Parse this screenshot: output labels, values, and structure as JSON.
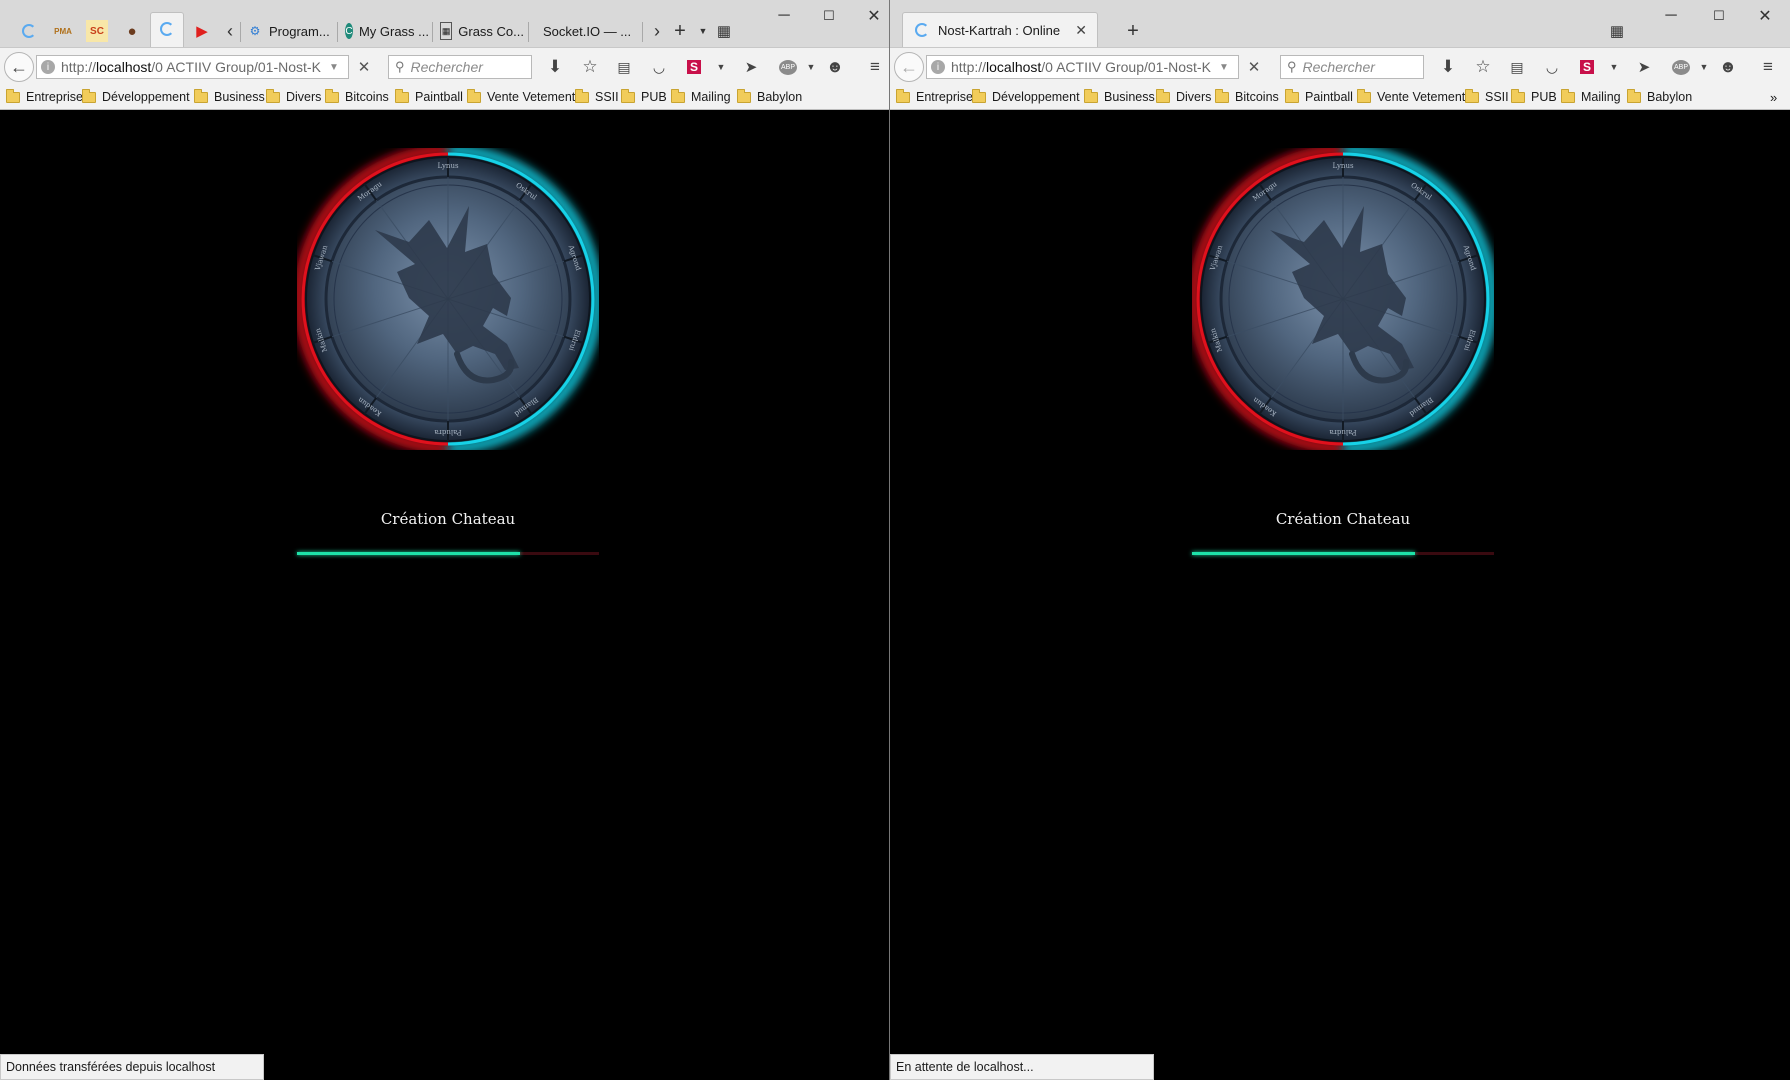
{
  "left_window": {
    "tabs": [
      {
        "title": "Program...",
        "favicon": "gear-icon"
      },
      {
        "title": "My Grass ...",
        "favicon": "grass-icon"
      },
      {
        "title": "Grass Co...",
        "favicon": "calculator-icon"
      },
      {
        "title": "Socket.IO — ...",
        "favicon": "socketio-icon"
      }
    ],
    "pinned_tabs": [
      "firefox-spinner-icon",
      "phpmyadmin-icon",
      "soc-icon",
      "wolf-icon",
      "firefox-spinner-icon",
      "youtube-icon"
    ],
    "pinned_texts": [
      "PMA",
      "SC"
    ],
    "url_prefix": "http://",
    "url_host": "localhost",
    "url_rest": "/0 ACTIIV Group/01-Nost-K",
    "search_placeholder": "Rechercher",
    "status": "Données transférées depuis localhost"
  },
  "right_window": {
    "active_tab_title": "Nost-Kartrah : Online",
    "url_prefix": "http://",
    "url_host": "localhost",
    "url_rest": "/0 ACTIIV Group/01-Nost-K",
    "search_placeholder": "Rechercher",
    "status": "En attente de localhost..."
  },
  "toolbar_icons": [
    "download-icon",
    "star-icon",
    "reader-icon",
    "pocket-icon",
    "s-addon-icon",
    "send-icon",
    "adblock-icon",
    "smiley-icon",
    "menu-icon"
  ],
  "adblock_label": "ABP",
  "s_addon_label": "S",
  "close_glyph": "✕",
  "bookmarks": [
    "Entreprise",
    "Développement",
    "Business",
    "Divers",
    "Bitcoins",
    "Paintball",
    "Vente Vetement",
    "SSII",
    "PUB",
    "Mailing",
    "Babylon"
  ],
  "game": {
    "loading_label": "Création Chateau",
    "progress": 0.74,
    "emblem_ring_names": [
      "Vjawan",
      "Moragu",
      "Lynus",
      "Oskrul",
      "Agrond",
      "Eldrui",
      "Blamud",
      "Paludra",
      "Keadun",
      "Malkin"
    ],
    "colors": {
      "red_glow": "#e0111d",
      "cyan_glow": "#17d2e8",
      "progress_fill": "#1ee3a9",
      "progress_track": "#3a0a10"
    }
  }
}
